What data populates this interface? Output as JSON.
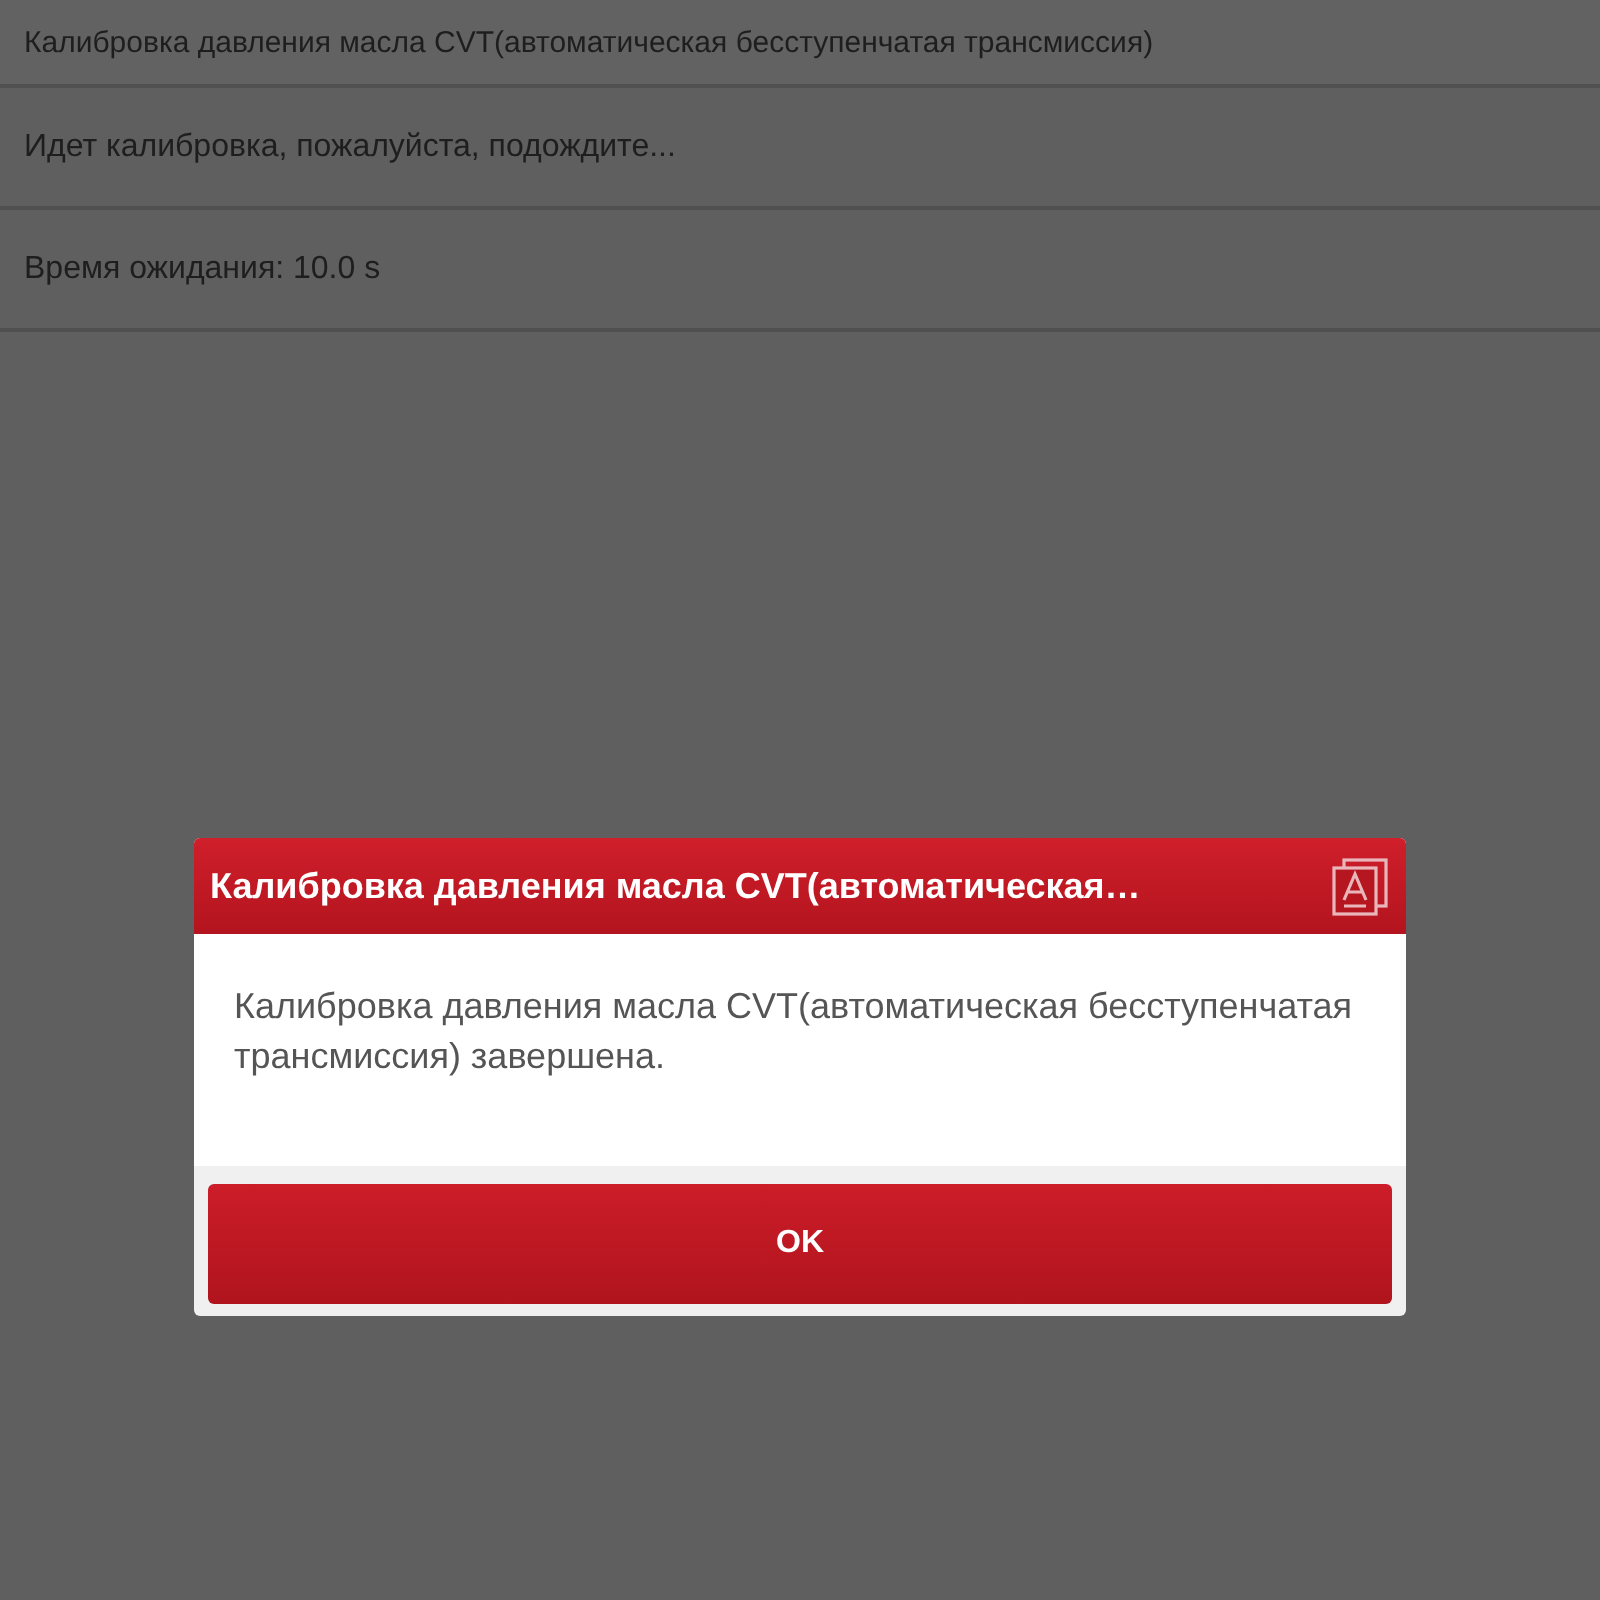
{
  "rows": [
    {
      "text": "Калибровка давления масла CVT(автоматическая бесступенчатая трансмиссия)",
      "kind": "header"
    },
    {
      "text": "Идет калибровка, пожалуйста, подождите...",
      "kind": "line"
    },
    {
      "text": "Время ожидания: 10.0 s",
      "kind": "line"
    }
  ],
  "dialog": {
    "title": "Калибровка давления масла CVT(автоматическая…",
    "message": "Калибровка давления масла CVT(автоматическая бесступенчатая трансмиссия) завершена.",
    "buttons": [
      "OK"
    ]
  }
}
